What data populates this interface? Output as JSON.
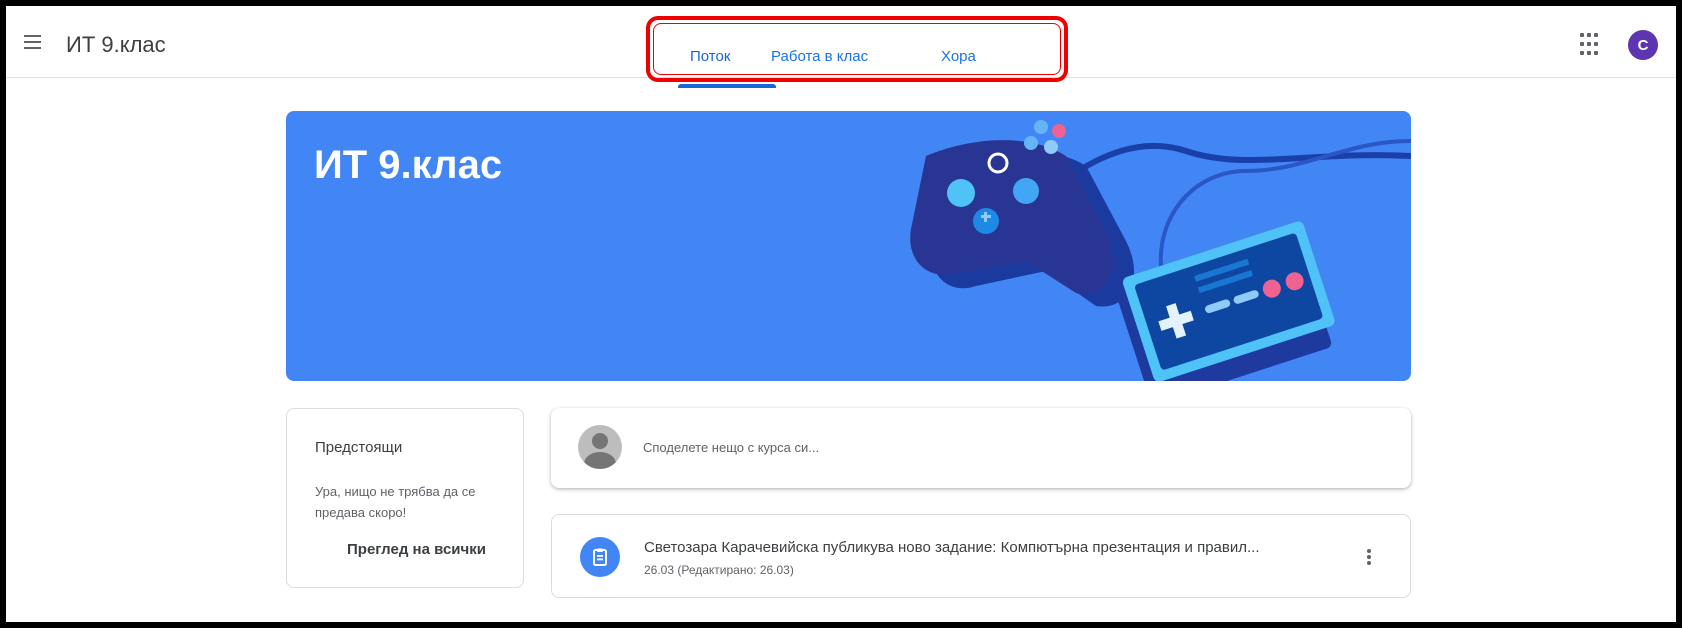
{
  "header": {
    "title": "ИТ 9.клас",
    "tabs": [
      {
        "label": "Поток",
        "active": true
      },
      {
        "label": "Работа в клас",
        "active": false
      },
      {
        "label": "Хора",
        "active": false
      }
    ],
    "avatar_letter": "C",
    "highlight_color": "#e00000"
  },
  "banner": {
    "title": "ИТ 9.клас",
    "color": "#4285f4",
    "illustration": "gamepad-controllers"
  },
  "upcoming": {
    "title": "Предстоящи",
    "text": "Ура, нищо не трябва да се предава скоро!",
    "link": "Преглед на всички"
  },
  "share": {
    "placeholder": "Споделете нещо с курса си..."
  },
  "posts": [
    {
      "title": "Светозара Карачевийска публикува ново задание: Компютърна презентация и правил...",
      "date": "26.03 (Редактирано: 26.03)",
      "icon": "assignment-icon"
    }
  ]
}
